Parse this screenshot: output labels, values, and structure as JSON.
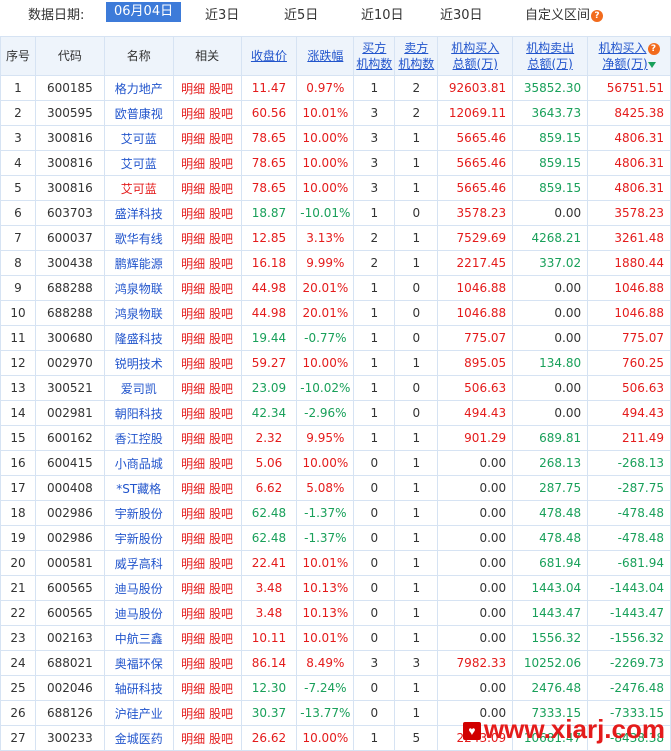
{
  "toolbar": {
    "date_label": "数据日期:",
    "options": [
      "06月04日",
      "近3日",
      "近5日",
      "近10日",
      "近30日",
      "自定义区间"
    ],
    "active_index": 0
  },
  "headers": {
    "seq": "序号",
    "code": "代码",
    "name": "名称",
    "related": "相关",
    "close": "收盘价",
    "change": "涨跌幅",
    "buy_inst_1": "买方",
    "buy_inst_2": "机构数",
    "sell_inst_1": "卖方",
    "sell_inst_2": "机构数",
    "inst_buy_1": "机构买入",
    "inst_buy_2": "总额(万)",
    "inst_sell_1": "机构卖出",
    "inst_sell_2": "总额(万)",
    "inst_net_1": "机构买入",
    "inst_net_2": "净额(万)"
  },
  "related_labels": {
    "detail": "明细",
    "forum": "股吧"
  },
  "rows": [
    {
      "seq": "1",
      "code": "600185",
      "name": "格力地产",
      "close": "11.47",
      "change": "0.97%",
      "buy": "1",
      "sell": "2",
      "ibuy": "92603.81",
      "isell": "35852.30",
      "inet": "56751.51",
      "dir": "up"
    },
    {
      "seq": "2",
      "code": "300595",
      "name": "欧普康视",
      "close": "60.56",
      "change": "10.01%",
      "buy": "3",
      "sell": "2",
      "ibuy": "12069.11",
      "isell": "3643.73",
      "inet": "8425.38",
      "dir": "up"
    },
    {
      "seq": "3",
      "code": "300816",
      "name": "艾可蓝",
      "close": "78.65",
      "change": "10.00%",
      "buy": "3",
      "sell": "1",
      "ibuy": "5665.46",
      "isell": "859.15",
      "inet": "4806.31",
      "dir": "up"
    },
    {
      "seq": "4",
      "code": "300816",
      "name": "艾可蓝",
      "close": "78.65",
      "change": "10.00%",
      "buy": "3",
      "sell": "1",
      "ibuy": "5665.46",
      "isell": "859.15",
      "inet": "4806.31",
      "dir": "up"
    },
    {
      "seq": "5",
      "code": "300816",
      "name": "艾可蓝",
      "close": "78.65",
      "change": "10.00%",
      "buy": "3",
      "sell": "1",
      "ibuy": "5665.46",
      "isell": "859.15",
      "inet": "4806.31",
      "dir": "up",
      "name_red": true
    },
    {
      "seq": "6",
      "code": "603703",
      "name": "盛洋科技",
      "close": "18.87",
      "change": "-10.01%",
      "buy": "1",
      "sell": "0",
      "ibuy": "3578.23",
      "isell": "0.00",
      "inet": "3578.23",
      "dir": "down"
    },
    {
      "seq": "7",
      "code": "600037",
      "name": "歌华有线",
      "close": "12.85",
      "change": "3.13%",
      "buy": "2",
      "sell": "1",
      "ibuy": "7529.69",
      "isell": "4268.21",
      "inet": "3261.48",
      "dir": "up"
    },
    {
      "seq": "8",
      "code": "300438",
      "name": "鹏辉能源",
      "close": "16.18",
      "change": "9.99%",
      "buy": "2",
      "sell": "1",
      "ibuy": "2217.45",
      "isell": "337.02",
      "inet": "1880.44",
      "dir": "up"
    },
    {
      "seq": "9",
      "code": "688288",
      "name": "鸿泉物联",
      "close": "44.98",
      "change": "20.01%",
      "buy": "1",
      "sell": "0",
      "ibuy": "1046.88",
      "isell": "0.00",
      "inet": "1046.88",
      "dir": "up"
    },
    {
      "seq": "10",
      "code": "688288",
      "name": "鸿泉物联",
      "close": "44.98",
      "change": "20.01%",
      "buy": "1",
      "sell": "0",
      "ibuy": "1046.88",
      "isell": "0.00",
      "inet": "1046.88",
      "dir": "up"
    },
    {
      "seq": "11",
      "code": "300680",
      "name": "隆盛科技",
      "close": "19.44",
      "change": "-0.77%",
      "buy": "1",
      "sell": "0",
      "ibuy": "775.07",
      "isell": "0.00",
      "inet": "775.07",
      "dir": "down"
    },
    {
      "seq": "12",
      "code": "002970",
      "name": "锐明技术",
      "close": "59.27",
      "change": "10.00%",
      "buy": "1",
      "sell": "1",
      "ibuy": "895.05",
      "isell": "134.80",
      "inet": "760.25",
      "dir": "up"
    },
    {
      "seq": "13",
      "code": "300521",
      "name": "爱司凯",
      "close": "23.09",
      "change": "-10.02%",
      "buy": "1",
      "sell": "0",
      "ibuy": "506.63",
      "isell": "0.00",
      "inet": "506.63",
      "dir": "down"
    },
    {
      "seq": "14",
      "code": "002981",
      "name": "朝阳科技",
      "close": "42.34",
      "change": "-2.96%",
      "buy": "1",
      "sell": "0",
      "ibuy": "494.43",
      "isell": "0.00",
      "inet": "494.43",
      "dir": "down"
    },
    {
      "seq": "15",
      "code": "600162",
      "name": "香江控股",
      "close": "2.32",
      "change": "9.95%",
      "buy": "1",
      "sell": "1",
      "ibuy": "901.29",
      "isell": "689.81",
      "inet": "211.49",
      "dir": "up"
    },
    {
      "seq": "16",
      "code": "600415",
      "name": "小商品城",
      "close": "5.06",
      "change": "10.00%",
      "buy": "0",
      "sell": "1",
      "ibuy": "0.00",
      "isell": "268.13",
      "inet": "-268.13",
      "dir": "up"
    },
    {
      "seq": "17",
      "code": "000408",
      "name": "*ST藏格",
      "close": "6.62",
      "change": "5.08%",
      "buy": "0",
      "sell": "1",
      "ibuy": "0.00",
      "isell": "287.75",
      "inet": "-287.75",
      "dir": "up"
    },
    {
      "seq": "18",
      "code": "002986",
      "name": "宇新股份",
      "close": "62.48",
      "change": "-1.37%",
      "buy": "0",
      "sell": "1",
      "ibuy": "0.00",
      "isell": "478.48",
      "inet": "-478.48",
      "dir": "down"
    },
    {
      "seq": "19",
      "code": "002986",
      "name": "宇新股份",
      "close": "62.48",
      "change": "-1.37%",
      "buy": "0",
      "sell": "1",
      "ibuy": "0.00",
      "isell": "478.48",
      "inet": "-478.48",
      "dir": "down"
    },
    {
      "seq": "20",
      "code": "000581",
      "name": "威孚高科",
      "close": "22.41",
      "change": "10.01%",
      "buy": "0",
      "sell": "1",
      "ibuy": "0.00",
      "isell": "681.94",
      "inet": "-681.94",
      "dir": "up"
    },
    {
      "seq": "21",
      "code": "600565",
      "name": "迪马股份",
      "close": "3.48",
      "change": "10.13%",
      "buy": "0",
      "sell": "1",
      "ibuy": "0.00",
      "isell": "1443.04",
      "inet": "-1443.04",
      "dir": "up"
    },
    {
      "seq": "22",
      "code": "600565",
      "name": "迪马股份",
      "close": "3.48",
      "change": "10.13%",
      "buy": "0",
      "sell": "1",
      "ibuy": "0.00",
      "isell": "1443.47",
      "inet": "-1443.47",
      "dir": "up"
    },
    {
      "seq": "23",
      "code": "002163",
      "name": "中航三鑫",
      "close": "10.11",
      "change": "10.01%",
      "buy": "0",
      "sell": "1",
      "ibuy": "0.00",
      "isell": "1556.32",
      "inet": "-1556.32",
      "dir": "up"
    },
    {
      "seq": "24",
      "code": "688021",
      "name": "奥福环保",
      "close": "86.14",
      "change": "8.49%",
      "buy": "3",
      "sell": "3",
      "ibuy": "7982.33",
      "isell": "10252.06",
      "inet": "-2269.73",
      "dir": "up"
    },
    {
      "seq": "25",
      "code": "002046",
      "name": "轴研科技",
      "close": "12.30",
      "change": "-7.24%",
      "buy": "0",
      "sell": "1",
      "ibuy": "0.00",
      "isell": "2476.48",
      "inet": "-2476.48",
      "dir": "down"
    },
    {
      "seq": "26",
      "code": "688126",
      "name": "沪硅产业",
      "close": "30.37",
      "change": "-13.77%",
      "buy": "0",
      "sell": "1",
      "ibuy": "0.00",
      "isell": "7333.15",
      "inet": "-7333.15",
      "dir": "down"
    },
    {
      "seq": "27",
      "code": "300233",
      "name": "金城医药",
      "close": "26.62",
      "change": "10.00%",
      "buy": "1",
      "sell": "5",
      "ibuy": "2243.09",
      "isell": "10681.47",
      "inet": "-8438.38",
      "dir": "up"
    }
  ],
  "watermark": {
    "text": "www.xiarj.com"
  },
  "colors": {
    "up": "#e41b1b",
    "down": "#19a05a",
    "link": "#2255cc",
    "active_bg": "#3d7bd9"
  }
}
